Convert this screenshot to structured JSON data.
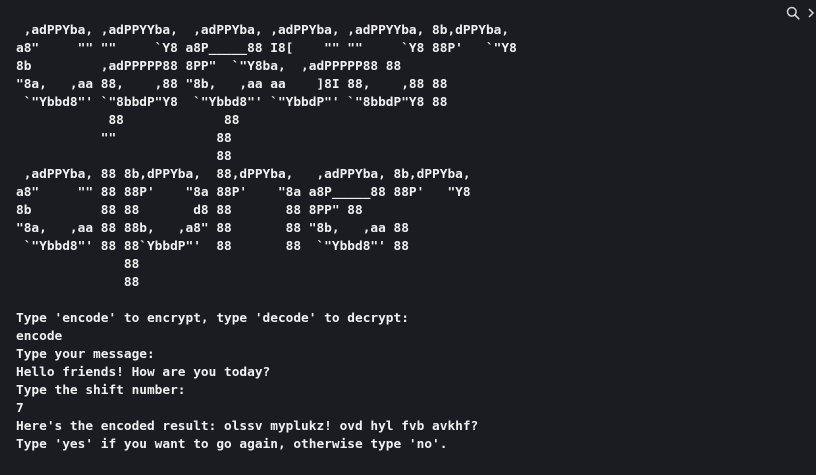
{
  "toolbar": {
    "search_icon": "search-icon",
    "more_icon": "more-icon"
  },
  "banner": {
    "lines": [
      " ,adPPYba, ,adPPYYba,  ,adPPYba, ,adPPYba, ,adPPYYba, 8b,dPPYba,",
      "a8\"     \"\" \"\"     `Y8 a8P_____88 I8[    \"\" \"\"     `Y8 88P'   `\"Y8",
      "8b         ,adPPPPP88 8PP\"  `\"Y8ba,  ,adPPPPP88 88",
      "\"8a,   ,aa 88,    ,88 \"8b,   ,aa aa    ]8I 88,    ,88 88",
      " `\"Ybbd8\"' `\"8bbdP\"Y8  `\"Ybbd8\"' `\"YbbdP\"' `\"8bbdP\"Y8 88",
      "            88             88",
      "           \"\"             88",
      "                          88",
      " ,adPPYba, 88 8b,dPPYba,  88,dPPYba,   ,adPPYba, 8b,dPPYba,",
      "a8\"     \"\" 88 88P'    \"8a 88P'    \"8a a8P_____88 88P'   \"Y8",
      "8b         88 88       d8 88       88 8PP\" 88",
      "\"8a,   ,aa 88 88b,   ,a8\" 88       88 \"8b,   ,aa 88",
      " `\"Ybbd8\"' 88 88`YbbdP\"'  88       88  `\"Ybbd8\"' 88",
      "              88",
      "              88"
    ]
  },
  "session": {
    "prompt_mode": "Type 'encode' to encrypt, type 'decode' to decrypt:",
    "input_mode": "encode",
    "prompt_message": "Type your message:",
    "input_message": "Hello friends! How are you today?",
    "prompt_shift": "Type the shift number:",
    "input_shift": "7",
    "result": "Here's the encoded result: olssv myplukz! ovd hyl fvb avkhf?",
    "prompt_again": "Type 'yes' if you want to go again, otherwise type 'no'."
  }
}
